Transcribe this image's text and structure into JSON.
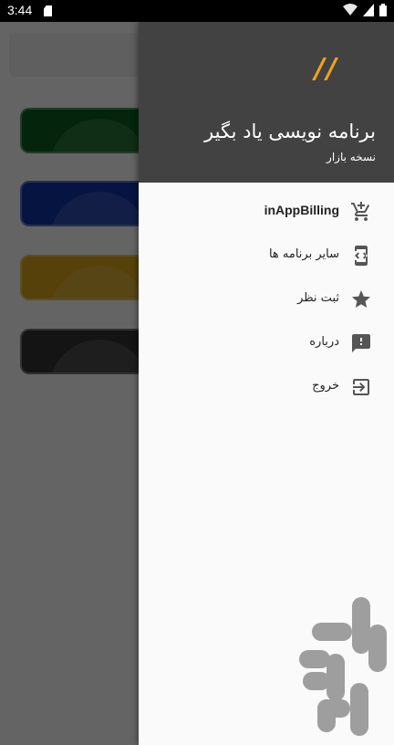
{
  "status_bar": {
    "time": "3:44"
  },
  "drawer": {
    "logo": "//",
    "title": "برنامه نویسی یاد بگیر",
    "subtitle": "نسخه بازار",
    "items": [
      {
        "label": "inAppBilling",
        "icon": "cart-plus-icon"
      },
      {
        "label": "سایر برنامه ها",
        "icon": "code-apps-icon"
      },
      {
        "label": "ثبت نظر",
        "icon": "star-icon"
      },
      {
        "label": "درباره",
        "icon": "feedback-icon"
      },
      {
        "label": "خروج",
        "icon": "exit-icon"
      }
    ]
  },
  "background_cards": [
    {
      "color": "#0b5d1e"
    },
    {
      "color": "#1034a6"
    },
    {
      "color": "#d9a21a"
    },
    {
      "color": "#333333"
    }
  ],
  "colors": {
    "drawer_header": "#424242",
    "accent": "#f0a020",
    "icon": "#555555"
  }
}
